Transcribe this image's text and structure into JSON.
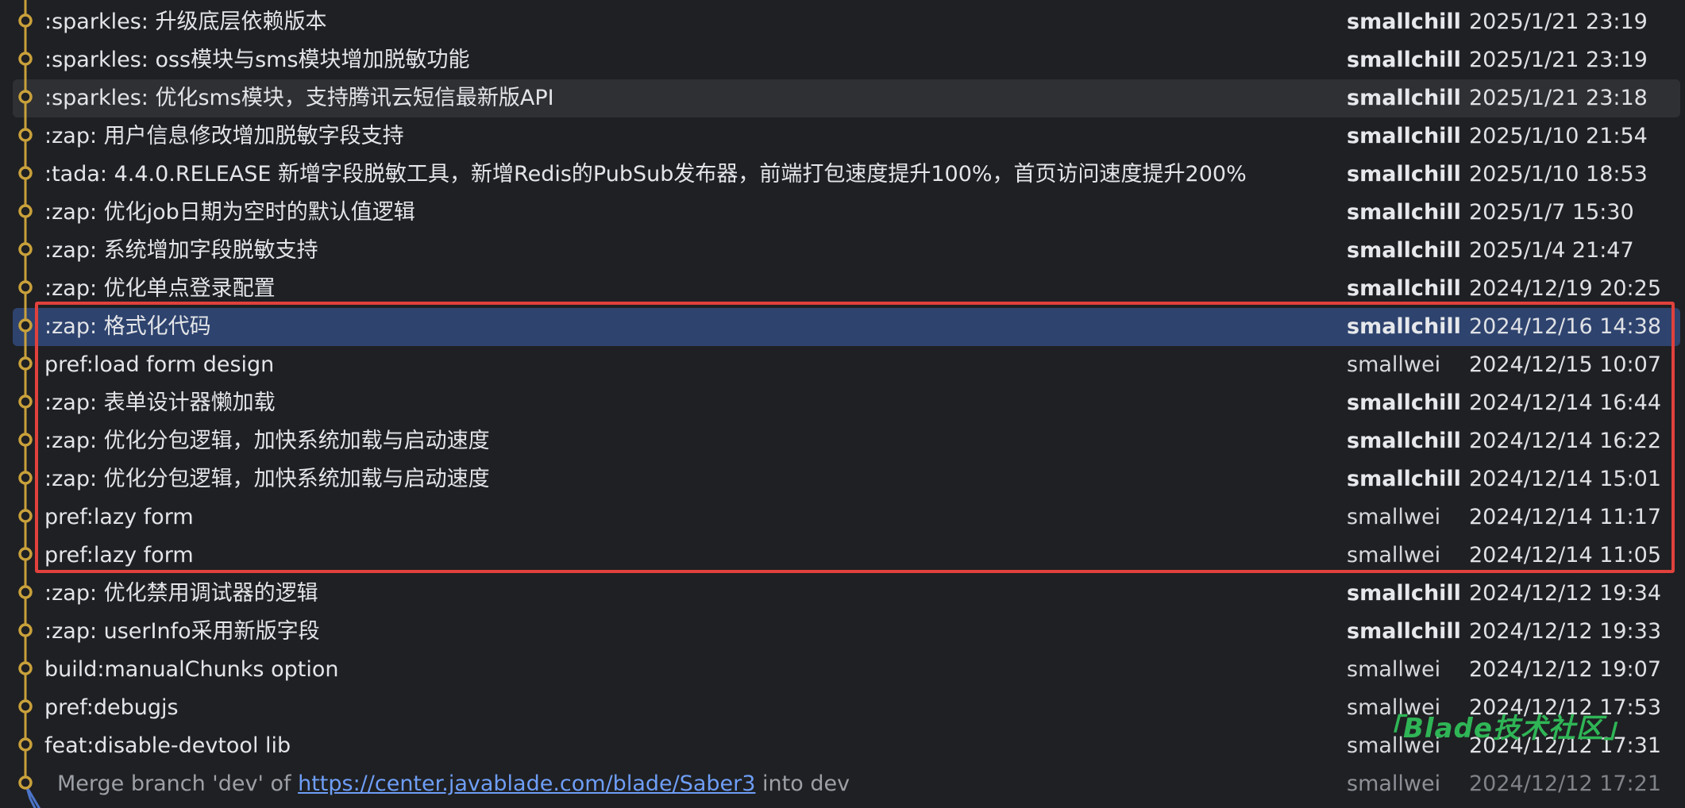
{
  "commits": [
    {
      "message": ":sparkles: 升级底层依赖版本",
      "author": "smallchill",
      "date": "2025/1/21 23:19",
      "bold": true
    },
    {
      "message": ":sparkles: oss模块与sms模块增加脱敏功能",
      "author": "smallchill",
      "date": "2025/1/21 23:19",
      "bold": true
    },
    {
      "message": ":sparkles: 优化sms模块，支持腾讯云短信最新版API",
      "author": "smallchill",
      "date": "2025/1/21 23:18",
      "bold": true,
      "hover": true
    },
    {
      "message": ":zap: 用户信息修改增加脱敏字段支持",
      "author": "smallchill",
      "date": "2025/1/10 21:54",
      "bold": true
    },
    {
      "message": ":tada: 4.4.0.RELEASE 新增字段脱敏工具，新增Redis的PubSub发布器，前端打包速度提升100%，首页访问速度提升200%",
      "author": "smallchill",
      "date": "2025/1/10 18:53",
      "bold": true
    },
    {
      "message": ":zap: 优化job日期为空时的默认值逻辑",
      "author": "smallchill",
      "date": "2025/1/7 15:30",
      "bold": true
    },
    {
      "message": ":zap: 系统增加字段脱敏支持",
      "author": "smallchill",
      "date": "2025/1/4 21:47",
      "bold": true
    },
    {
      "message": ":zap: 优化单点登录配置",
      "author": "smallchill",
      "date": "2024/12/19 20:25",
      "bold": true
    },
    {
      "message": ":zap: 格式化代码",
      "author": "smallchill",
      "date": "2024/12/16 14:38",
      "bold": true,
      "selected": true
    },
    {
      "message": "pref:load form design",
      "author": "smallwei",
      "date": "2024/12/15 10:07",
      "bold": false
    },
    {
      "message": ":zap: 表单设计器懒加载",
      "author": "smallchill",
      "date": "2024/12/14 16:44",
      "bold": true
    },
    {
      "message": ":zap: 优化分包逻辑，加快系统加载与启动速度",
      "author": "smallchill",
      "date": "2024/12/14 16:22",
      "bold": true
    },
    {
      "message": ":zap: 优化分包逻辑，加快系统加载与启动速度",
      "author": "smallchill",
      "date": "2024/12/14 15:01",
      "bold": true
    },
    {
      "message": "pref:lazy form",
      "author": "smallwei",
      "date": "2024/12/14 11:17",
      "bold": false
    },
    {
      "message": "pref:lazy form",
      "author": "smallwei",
      "date": "2024/12/14 11:05",
      "bold": false
    },
    {
      "message": ":zap: 优化禁用调试器的逻辑",
      "author": "smallchill",
      "date": "2024/12/12 19:34",
      "bold": true
    },
    {
      "message": ":zap: userInfo采用新版字段",
      "author": "smallchill",
      "date": "2024/12/12 19:33",
      "bold": true
    },
    {
      "message": "build:manualChunks option",
      "author": "smallwei",
      "date": "2024/12/12 19:07",
      "bold": false
    },
    {
      "message": "pref:debugjs",
      "author": "smallwei",
      "date": "2024/12/12 17:53",
      "bold": false
    },
    {
      "message": "feat:disable-devtool lib",
      "author": "smallwei",
      "date": "2024/12/12 17:31",
      "bold": false
    },
    {
      "message_prefix": "Merge branch 'dev' of ",
      "message_link": "https://center.javablade.com/blade/Saber3",
      "message_suffix": " into dev",
      "author": "smallwei",
      "date": "2024/12/12 17:21",
      "bold": false,
      "merge": true
    }
  ],
  "watermark": "「Blade技术社区」",
  "colors": {
    "node": "#c9a13b",
    "line": "#c9a13b",
    "merge_line": "#4b74c9",
    "highlight": "#e0413d",
    "selected_row": "#2e436e",
    "link": "#6e9ef7"
  }
}
